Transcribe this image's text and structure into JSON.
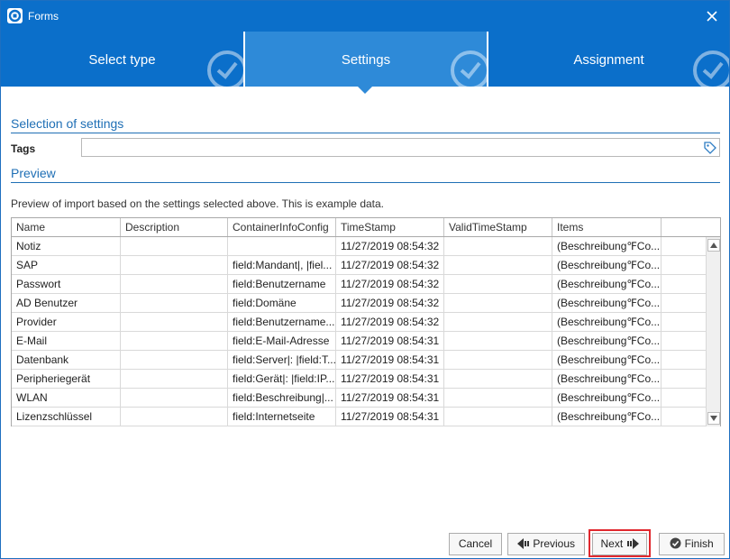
{
  "window": {
    "title": "Forms",
    "close_icon": "close-icon",
    "app_icon": "app-logo-icon"
  },
  "steps": [
    {
      "label": "Select type",
      "state": "completed"
    },
    {
      "label": "Settings",
      "state": "active"
    },
    {
      "label": "Assignment",
      "state": "pending"
    }
  ],
  "settings": {
    "section_title": "Selection of settings",
    "tags_label": "Tags",
    "tags_value": "",
    "tags_icon": "tag-icon"
  },
  "preview": {
    "section_title": "Preview",
    "description": "Preview of import based on the settings selected above. This is example data.",
    "columns": [
      "Name",
      "Description",
      "ContainerInfoConfig",
      "TimeStamp",
      "ValidTimeStamp",
      "Items"
    ],
    "rows": [
      [
        "Notiz",
        "",
        "",
        "11/27/2019 08:54:32",
        "",
        "(Beschreibung℉Co..."
      ],
      [
        "SAP",
        "",
        "field:Mandant|, |fiel...",
        "11/27/2019 08:54:32",
        "",
        "(Beschreibung℉Co..."
      ],
      [
        "Passwort",
        "",
        "field:Benutzername",
        "11/27/2019 08:54:32",
        "",
        "(Beschreibung℉Co..."
      ],
      [
        "AD Benutzer",
        "",
        "field:Domäne",
        "11/27/2019 08:54:32",
        "",
        "(Beschreibung℉Co..."
      ],
      [
        "Provider",
        "",
        "field:Benutzername...",
        "11/27/2019 08:54:32",
        "",
        "(Beschreibung℉Co..."
      ],
      [
        "E-Mail",
        "",
        "field:E-Mail-Adresse",
        "11/27/2019 08:54:31",
        "",
        "(Beschreibung℉Co..."
      ],
      [
        "Datenbank",
        "",
        "field:Server|: |field:T...",
        "11/27/2019 08:54:31",
        "",
        "(Beschreibung℉Co..."
      ],
      [
        "Peripheriegerät",
        "",
        "field:Gerät|: |field:IP...",
        "11/27/2019 08:54:31",
        "",
        "(Beschreibung℉Co..."
      ],
      [
        "WLAN",
        "",
        "field:Beschreibung|...",
        "11/27/2019 08:54:31",
        "",
        "(Beschreibung℉Co..."
      ],
      [
        "Lizenzschlüssel",
        "",
        "field:Internetseite",
        "11/27/2019 08:54:31",
        "",
        "(Beschreibung℉Co..."
      ]
    ]
  },
  "buttons": {
    "cancel": "Cancel",
    "previous": "Previous",
    "next": "Next",
    "finish": "Finish"
  },
  "colors": {
    "title_bar": "#0b6fca",
    "step_active": "#2e8ad8",
    "section_accent": "#1f6fb5",
    "highlight": "#e0282e"
  }
}
